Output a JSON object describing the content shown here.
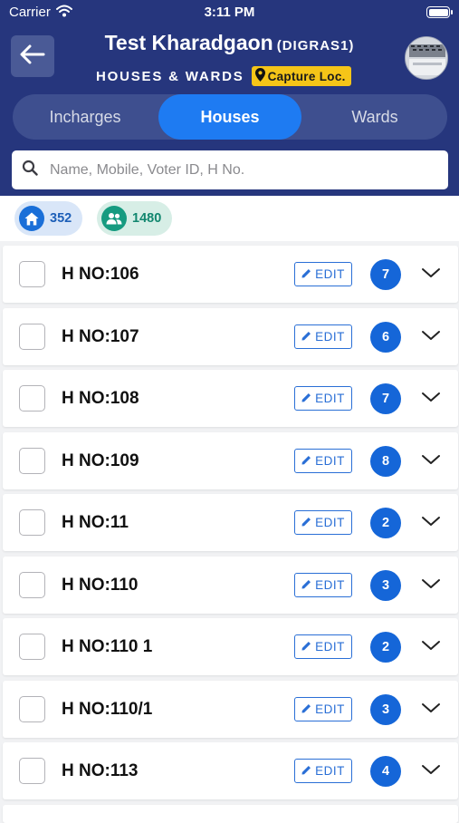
{
  "status_bar": {
    "carrier": "Carrier",
    "time": "3:11 PM"
  },
  "header": {
    "title": "Test Kharadgaon",
    "title_code": "(DIGRAS1)",
    "subtitle": "HOUSES & WARDS",
    "capture_label": "Capture Loc."
  },
  "tabs": [
    {
      "label": "Incharges",
      "active": false
    },
    {
      "label": "Houses",
      "active": true
    },
    {
      "label": "Wards",
      "active": false
    }
  ],
  "search": {
    "placeholder": "Name, Mobile, Voter ID, H No.",
    "value": ""
  },
  "stats": {
    "houses_count": "352",
    "voters_count": "1480"
  },
  "edit_label": "EDIT",
  "houses": [
    {
      "hno": "H NO:106",
      "count": "7"
    },
    {
      "hno": "H NO:107",
      "count": "6"
    },
    {
      "hno": "H NO:108",
      "count": "7"
    },
    {
      "hno": "H NO:109",
      "count": "8"
    },
    {
      "hno": "H NO:11",
      "count": "2"
    },
    {
      "hno": "H NO:110",
      "count": "3"
    },
    {
      "hno": "H NO:110 1",
      "count": "2"
    },
    {
      "hno": "H NO:110/1",
      "count": "3"
    },
    {
      "hno": "H NO:113",
      "count": "4"
    }
  ],
  "colors": {
    "header_bg": "#26367d",
    "active_tab": "#1e7bf2",
    "accent_blue": "#1566d8",
    "badge_yellow": "#f5c518",
    "voters_green": "#169b80"
  }
}
